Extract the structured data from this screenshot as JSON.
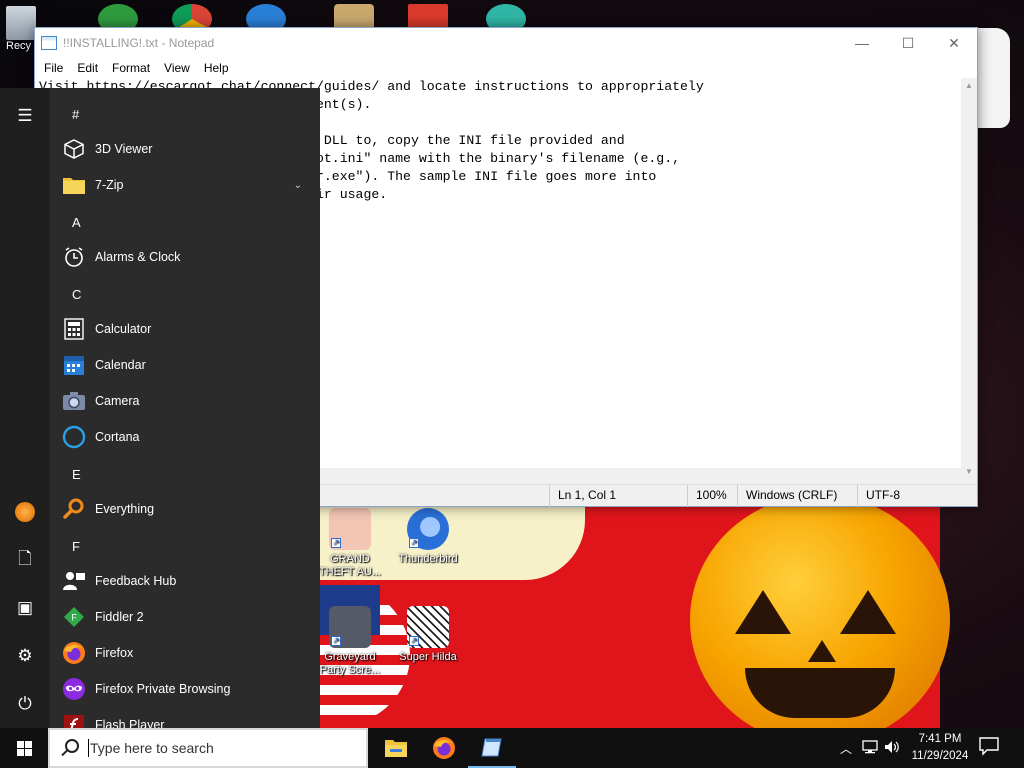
{
  "desktop": {
    "icons": [
      {
        "name": "recycle-bin",
        "label": "Recy"
      },
      {
        "name": "gta",
        "label": "GRAND THEFT AU..."
      },
      {
        "name": "thunderbird",
        "label": "Thunderbird"
      },
      {
        "name": "graveyard",
        "label": "Graveyard Party Scre..."
      },
      {
        "name": "super-hilda",
        "label": "Super Hilda"
      }
    ]
  },
  "notepad": {
    "title": "!!INSTALLING!.txt - Notepad",
    "menu": [
      "File",
      "Edit",
      "Format",
      "View",
      "Help"
    ],
    "caption": {
      "minimize": "—",
      "maximize": "☐",
      "close": "✕"
    },
    "lines": [
      "Visit https://escargot.chat/connect/guides/ and locate instructions to appropriately",
      "                                client(s).",
      "",
      "                                the DLL to, copy the INI file provided and",
      "                                argot.ini\" name with the binary's filename (e.g.,",
      "                                msgr.exe\"). The sample INI file goes more into",
      "                                their usage."
    ],
    "status": {
      "position": "Ln 1, Col 1",
      "zoom": "100%",
      "line_ending": "Windows (CRLF)",
      "encoding": "UTF-8"
    }
  },
  "start_menu": {
    "sections": [
      {
        "letter": "#",
        "apps": [
          {
            "label": "3D Viewer",
            "icon": "cube-icon",
            "glyph": "⬡",
            "color": "#2b2b2b"
          },
          {
            "label": "7-Zip",
            "icon": "folder-icon",
            "glyph": "",
            "color": "#f0c23c",
            "expandable": true
          }
        ]
      },
      {
        "letter": "A",
        "apps": [
          {
            "label": "Alarms & Clock",
            "icon": "alarm-clock-icon",
            "glyph": "◷",
            "color": "#2b2b2b"
          }
        ]
      },
      {
        "letter": "C",
        "apps": [
          {
            "label": "Calculator",
            "icon": "calculator-icon",
            "glyph": "▦",
            "color": "#2b2b2b"
          },
          {
            "label": "Calendar",
            "icon": "calendar-icon",
            "glyph": "▦",
            "color": "#2a7fd8"
          },
          {
            "label": "Camera",
            "icon": "camera-icon",
            "glyph": "◉",
            "color": "#7d8aa6"
          },
          {
            "label": "Cortana",
            "icon": "cortana-icon",
            "glyph": "○",
            "color": "#2b2b2b"
          }
        ]
      },
      {
        "letter": "E",
        "apps": [
          {
            "label": "Everything",
            "icon": "search-tool-icon",
            "glyph": "⚲",
            "color": "#e07b10"
          }
        ]
      },
      {
        "letter": "F",
        "apps": [
          {
            "label": "Feedback Hub",
            "icon": "feedback-hub-icon",
            "glyph": "☺",
            "color": "#2b2b2b"
          },
          {
            "label": "Fiddler 2",
            "icon": "fiddler-icon",
            "glyph": "◆",
            "color": "#2eaa4a"
          },
          {
            "label": "Firefox",
            "icon": "firefox-icon",
            "glyph": "●",
            "color": "#ff7a1a"
          },
          {
            "label": "Firefox Private Browsing",
            "icon": "firefox-private-icon",
            "glyph": "∞",
            "color": "#8a2be2"
          },
          {
            "label": "Flash Player",
            "icon": "flash-icon",
            "glyph": "ƒ",
            "color": "#c21b1b"
          }
        ]
      }
    ],
    "rail": {
      "menu": "hamburger-icon",
      "user": "user-avatar-icon",
      "documents": "document-icon",
      "pictures": "pictures-icon",
      "settings": "gear-icon",
      "power": "power-icon"
    }
  },
  "taskbar": {
    "search_placeholder": "Type here to search",
    "clock_time": "7:41 PM",
    "clock_date": "11/29/2024"
  }
}
